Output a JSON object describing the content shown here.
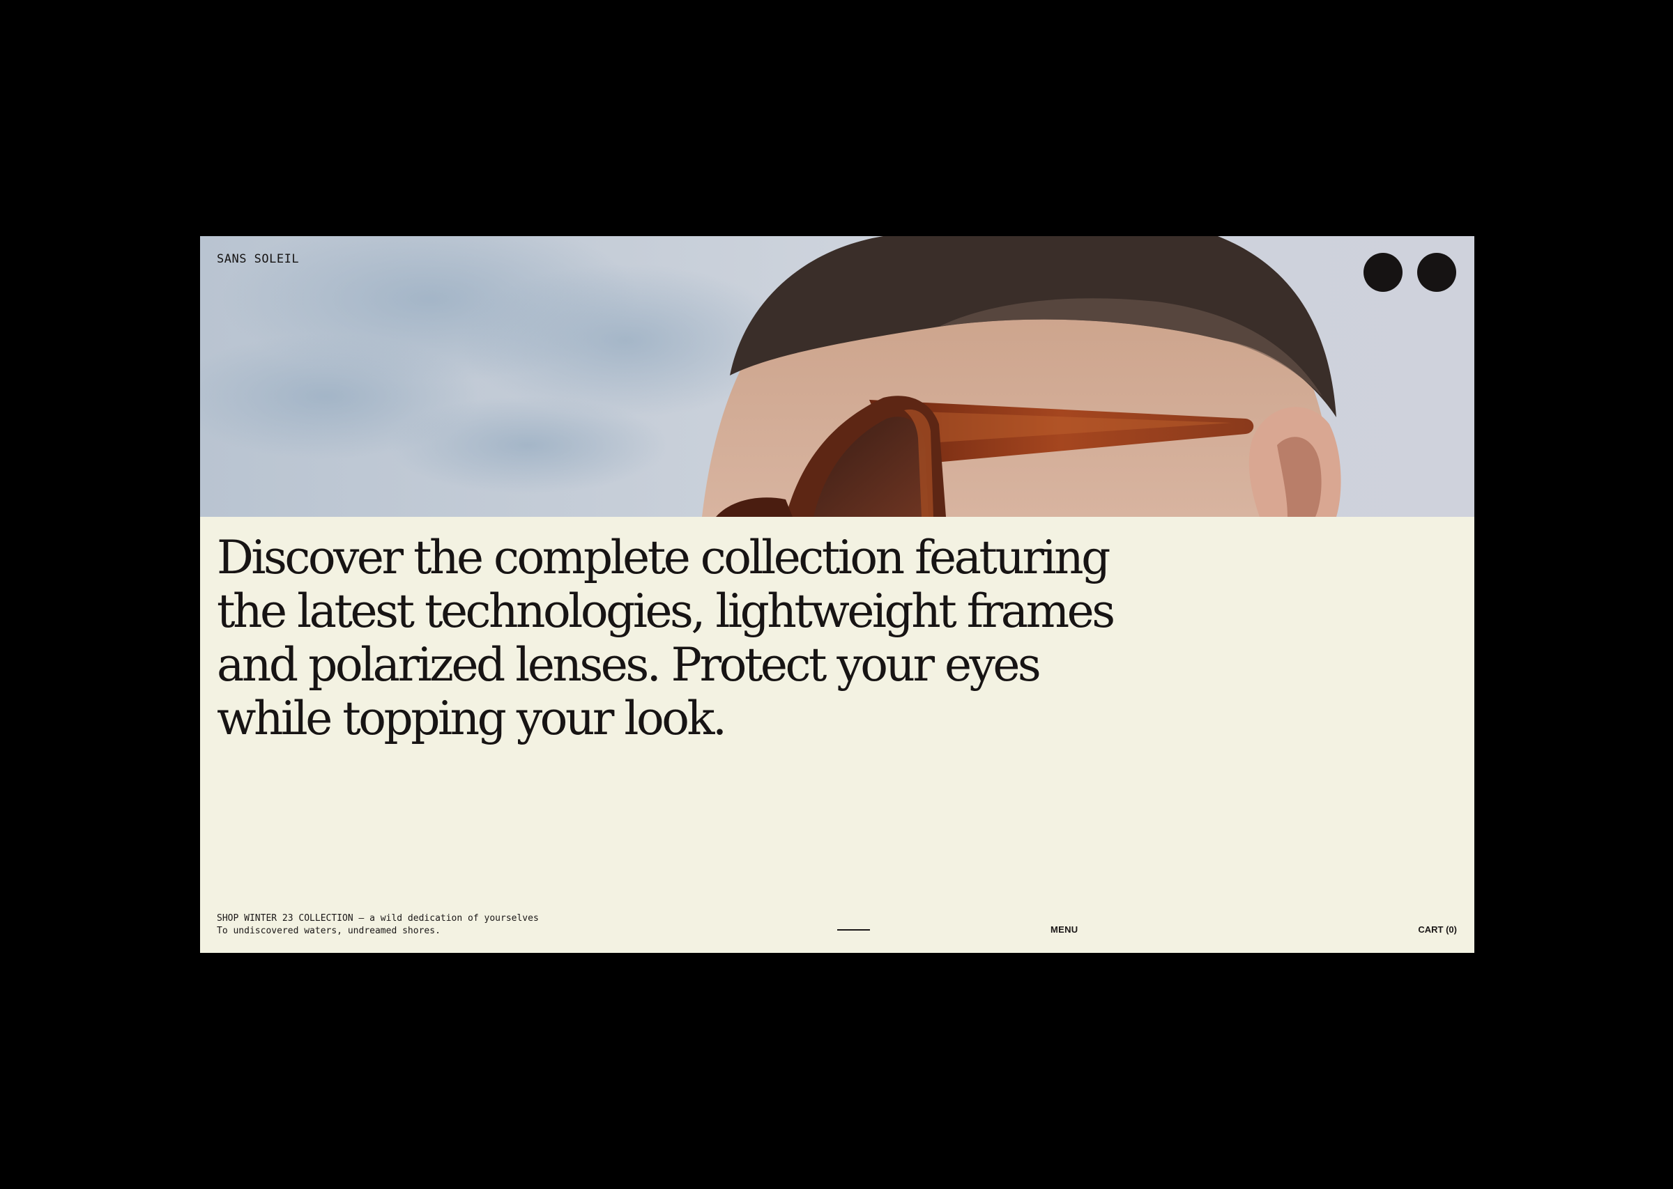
{
  "header": {
    "brand": "SANS SOLEIL"
  },
  "hero": {
    "image_subject": "man wearing brown tortoise sunglasses against cloudy sky"
  },
  "headline": "Discover the complete collection featuring the latest technologies, lightweight frames and polarized lenses. Protect your eyes while topping your look.",
  "footer": {
    "promo_line1": "SHOP WINTER 23 COLLECTION — a wild dedication of yourselves",
    "promo_line2": "To undiscovered waters, undreamed shores.",
    "menu_label": "MENU",
    "cart_label": "CART (0)"
  },
  "colors": {
    "page_background": "#000000",
    "panel_background": "#f3f2e2",
    "text": "#171414",
    "buttons": "#161313"
  }
}
